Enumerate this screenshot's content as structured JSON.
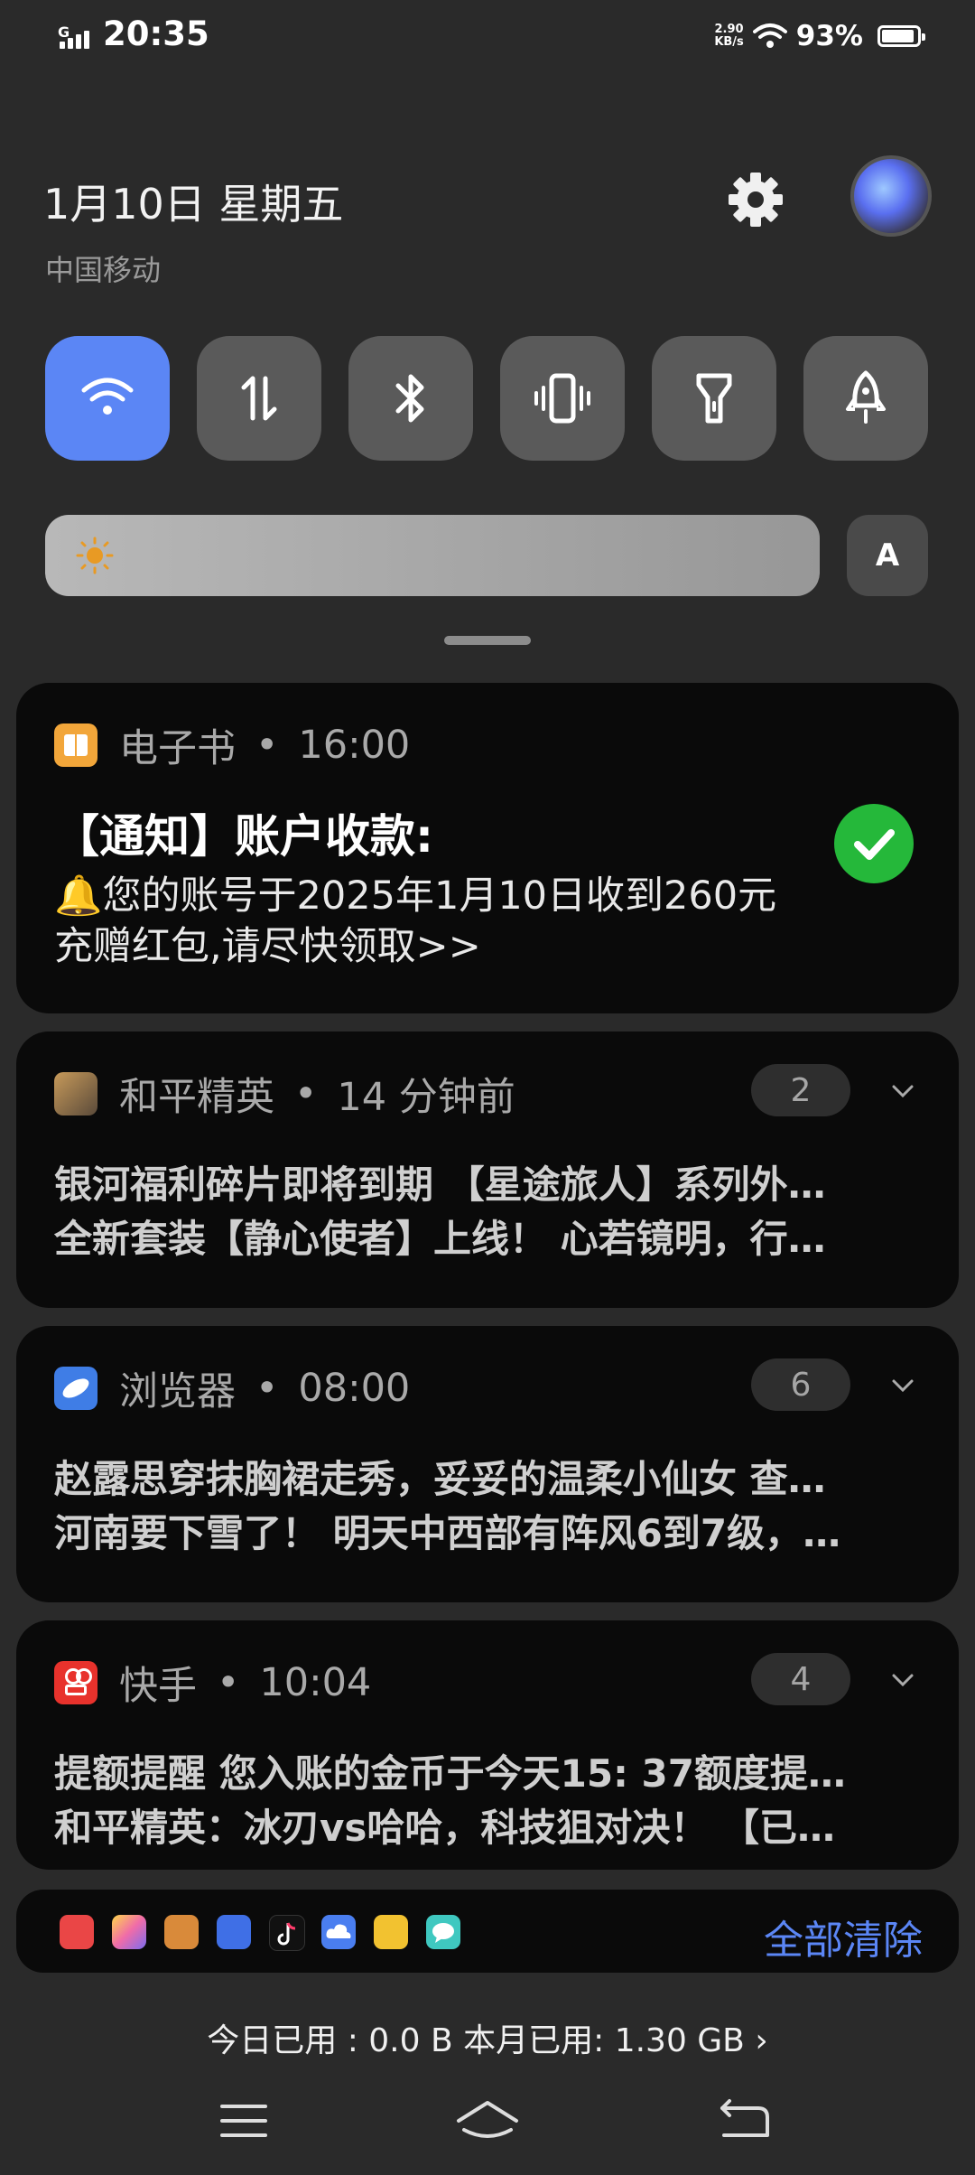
{
  "status_bar": {
    "network": "G",
    "time": "20:35",
    "speed_value": "2.90",
    "speed_unit": "KB/s",
    "battery_percent": "93%",
    "battery_level": 0.93
  },
  "header": {
    "date": "1月10日 星期五",
    "carrier": "中国移动",
    "settings_icon": "gear-icon"
  },
  "quick_toggles": [
    {
      "name": "wifi",
      "icon": "wifi-icon",
      "on": true
    },
    {
      "name": "mobile-data",
      "icon": "data-arrows-icon",
      "on": false
    },
    {
      "name": "bluetooth",
      "icon": "bluetooth-icon",
      "on": false
    },
    {
      "name": "vibrate",
      "icon": "vibrate-icon",
      "on": false
    },
    {
      "name": "flashlight",
      "icon": "flashlight-icon",
      "on": false
    },
    {
      "name": "rocket",
      "icon": "rocket-icon",
      "on": false
    }
  ],
  "brightness": {
    "auto_label": "A",
    "level": 0.05
  },
  "notifications": [
    {
      "app": "电子书",
      "time": "16:00",
      "title": "【通知】账户收款:",
      "body": "🔔您的账号于2025年1月10日收到260元充赠红包,请尽快领取>>"
    },
    {
      "app": "和平精英",
      "time": "14 分钟前",
      "count": "2",
      "lines": [
        "银河福利碎片即将到期 【星途旅人】系列外…",
        "全新套装【静心使者】上线！ 心若镜明，行…"
      ]
    },
    {
      "app": "浏览器",
      "time": "08:00",
      "count": "6",
      "lines": [
        "赵露思穿抹胸裙走秀，妥妥的温柔小仙女 查…",
        "河南要下雪了！ 明天中西部有阵风6到7级，…"
      ]
    },
    {
      "app": "快手",
      "time": "10:04",
      "count": "4",
      "lines": [
        "提额提醒 您入账的金币于今天15: 37额度提…",
        "和平精英：冰刃vs哈哈，科技狙对决！ 【已…"
      ]
    }
  ],
  "tray": {
    "clear_all": "全部清除",
    "colors": {
      "accent": "#5b86f5",
      "check": "#25b83a"
    }
  },
  "usage": {
    "text": "今日已用 : 0.0 B 本月已用: 1.30 GB ›"
  }
}
